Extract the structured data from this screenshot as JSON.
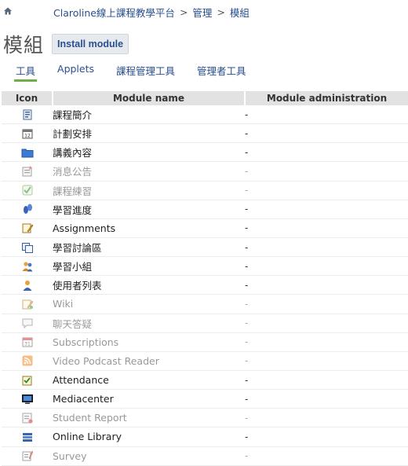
{
  "breadcrumb": {
    "items": [
      "Claroline線上課程教學平台",
      "管理",
      "模組"
    ],
    "separator": ">"
  },
  "page": {
    "title": "模組",
    "install_button": "Install module"
  },
  "tabs": [
    {
      "label": "工具",
      "active": true
    },
    {
      "label": "Applets",
      "active": false
    },
    {
      "label": "課程管理工具",
      "active": false
    },
    {
      "label": "管理者工具",
      "active": false
    }
  ],
  "table": {
    "headers": [
      "Icon",
      "Module name",
      "Module administration"
    ],
    "rows": [
      {
        "icon": "course-description-icon",
        "name": "課程簡介",
        "admin": "-",
        "enabled": true
      },
      {
        "icon": "calendar-icon",
        "name": "計劃安排",
        "admin": "-",
        "enabled": true
      },
      {
        "icon": "folder-icon",
        "name": "講義內容",
        "admin": "-",
        "enabled": true
      },
      {
        "icon": "announcement-icon",
        "name": "消息公告",
        "admin": "-",
        "enabled": false
      },
      {
        "icon": "exercise-checkmark-icon",
        "name": "課程練習",
        "admin": "-",
        "enabled": false
      },
      {
        "icon": "learning-path-icon",
        "name": "學習進度",
        "admin": "-",
        "enabled": true
      },
      {
        "icon": "assignment-icon",
        "name": "Assignments",
        "admin": "-",
        "enabled": true
      },
      {
        "icon": "forum-icon",
        "name": "學習討論區",
        "admin": "-",
        "enabled": true
      },
      {
        "icon": "group-icon",
        "name": "學習小組",
        "admin": "-",
        "enabled": true
      },
      {
        "icon": "user-icon",
        "name": "使用者列表",
        "admin": "-",
        "enabled": true
      },
      {
        "icon": "wiki-icon",
        "name": "Wiki",
        "admin": "-",
        "enabled": false
      },
      {
        "icon": "chat-icon",
        "name": "聊天答疑",
        "admin": "-",
        "enabled": false
      },
      {
        "icon": "subscriptions-calendar-icon",
        "name": "Subscriptions",
        "admin": "-",
        "enabled": false
      },
      {
        "icon": "rss-icon",
        "name": "Video Podcast Reader",
        "admin": "-",
        "enabled": false
      },
      {
        "icon": "attendance-icon",
        "name": "Attendance",
        "admin": "-",
        "enabled": true
      },
      {
        "icon": "monitor-icon",
        "name": "Mediacenter",
        "admin": "-",
        "enabled": true
      },
      {
        "icon": "report-icon",
        "name": "Student Report",
        "admin": "-",
        "enabled": false
      },
      {
        "icon": "library-books-icon",
        "name": "Online Library",
        "admin": "-",
        "enabled": true
      },
      {
        "icon": "survey-icon",
        "name": "Survey",
        "admin": "-",
        "enabled": false
      }
    ]
  }
}
